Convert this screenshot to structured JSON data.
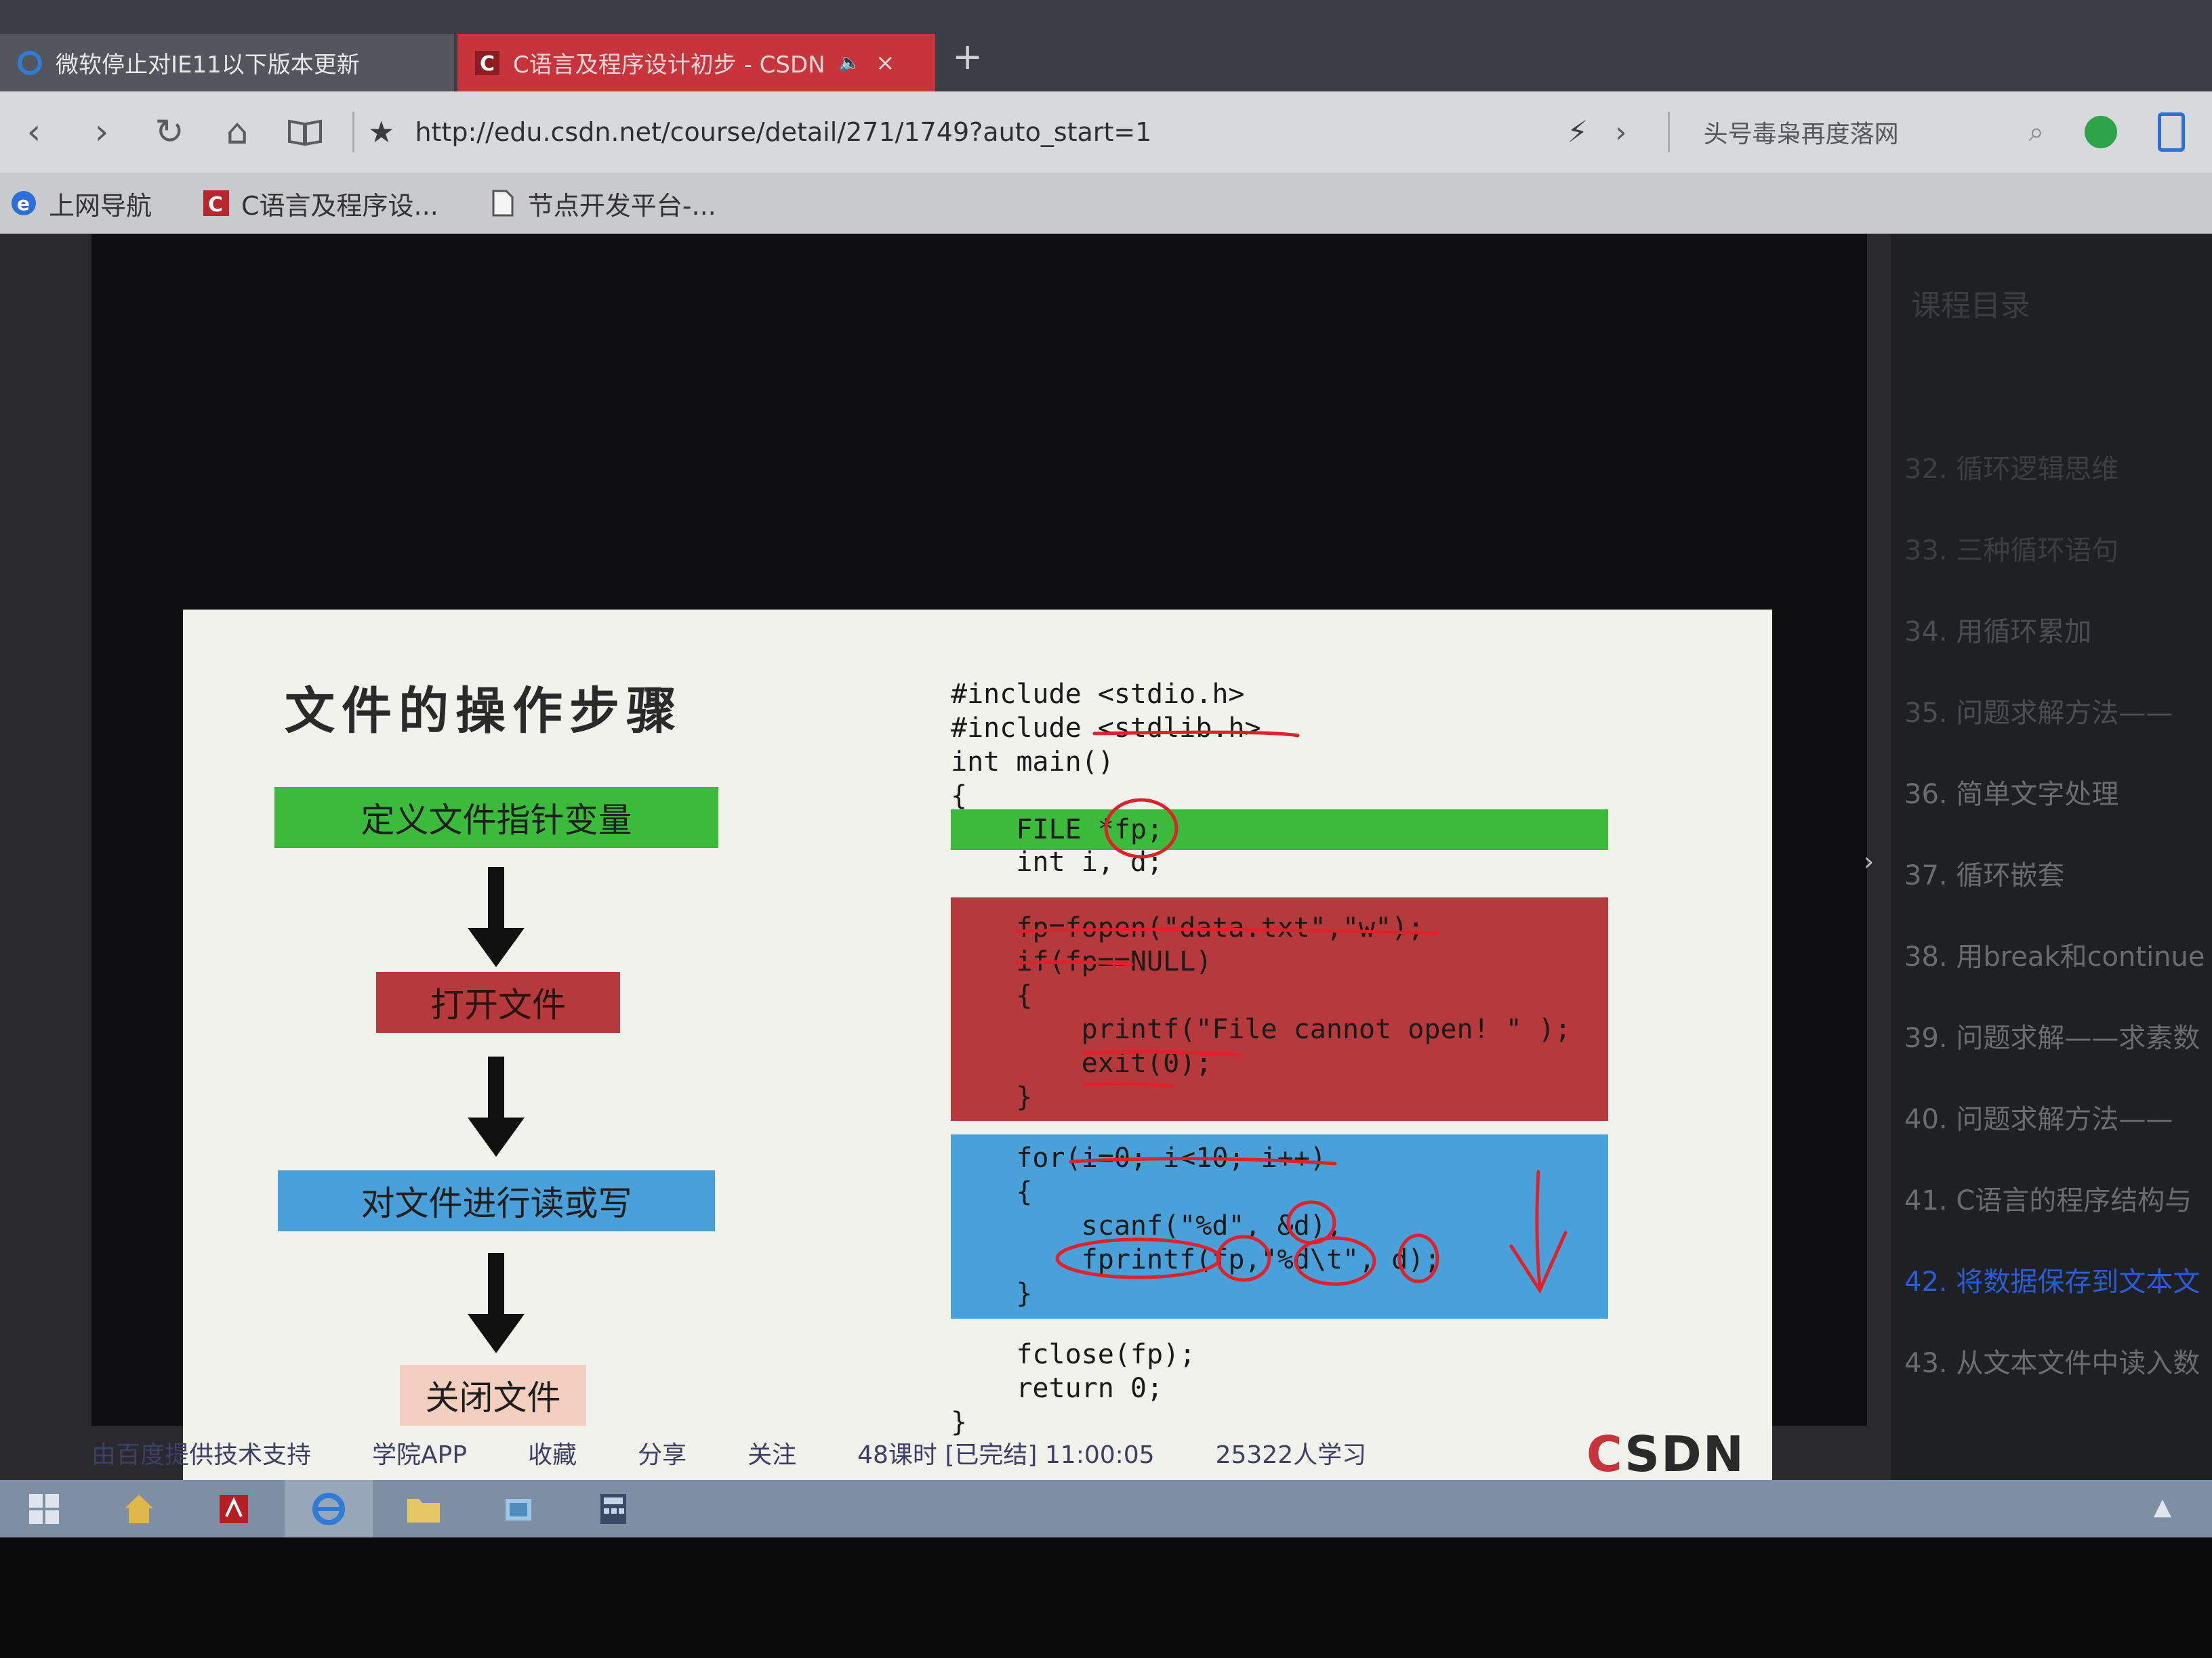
{
  "browser": {
    "tabs": [
      {
        "title": "微软停止对IE11以下版本更新",
        "active": false
      },
      {
        "title": "C语言及程序设计初步 - CSDN",
        "active": true
      }
    ],
    "new_tab": "+",
    "url": "http://edu.csdn.net/course/detail/271/1749?auto_start=1",
    "search_text": "头号毒枭再度落网",
    "bookmarks": [
      "上网导航",
      "C语言及程序设...",
      "节点开发平台-..."
    ]
  },
  "slide": {
    "title": "文件的操作步骤",
    "steps": [
      "定义文件指针变量",
      "打开文件",
      "对文件进行读或写",
      "关闭文件"
    ],
    "code": [
      "#include <stdio.h>",
      "#include <stdlib.h>",
      "int main()",
      "{",
      "    FILE *fp;",
      "    int i, d;",
      "    fp=fopen(\"data.txt\",\"w\");",
      "    if(fp==NULL)",
      "    {",
      "        printf(\"File cannot open! \" );",
      "        exit(0);",
      "    }",
      "    for(i=0; i<10; i++)",
      "    {",
      "        scanf(\"%d\", &d);",
      "        fprintf(fp,\"%d\\t\", d);",
      "    }",
      "    fclose(fp);",
      "    return 0;",
      "}"
    ],
    "logo": {
      "c": "C",
      "rest": "SDN"
    }
  },
  "chapters": {
    "heading": "课程目录",
    "items": [
      {
        "label": "32. 循环逻辑思维",
        "state": "dim"
      },
      {
        "label": "33. 三种循环语句",
        "state": "dim"
      },
      {
        "label": "34. 用循环累加",
        "state": "normal"
      },
      {
        "label": "35. 问题求解方法——",
        "state": "normal"
      },
      {
        "label": "36. 简单文字处理",
        "state": "normal"
      },
      {
        "label": "37. 循环嵌套",
        "state": "normal"
      },
      {
        "label": "38. 用break和continue",
        "state": "normal"
      },
      {
        "label": "39. 问题求解——求素数",
        "state": "normal"
      },
      {
        "label": "40. 问题求解方法——",
        "state": "normal"
      },
      {
        "label": "41. C语言的程序结构与",
        "state": "normal"
      },
      {
        "label": "42. 将数据保存到文本文",
        "state": "active"
      },
      {
        "label": "43. 从文本文件中读入数",
        "state": "normal"
      }
    ]
  },
  "info": {
    "support": "由百度提供技术支持",
    "app": "学院APP",
    "favorite": "收藏",
    "share": "分享",
    "follow": "关注",
    "lessons": "48课时 [已完结] 11:00:05",
    "learners": "25322人学习"
  },
  "colors": {
    "step1": "#3cba3c",
    "step2": "#b6393b",
    "step3": "#4aa0d8",
    "step4": "#f3cfc0",
    "active_tab": "#c7343b",
    "active_chapter": "#2b5bd6",
    "annotation_ink": "#e0202a"
  }
}
